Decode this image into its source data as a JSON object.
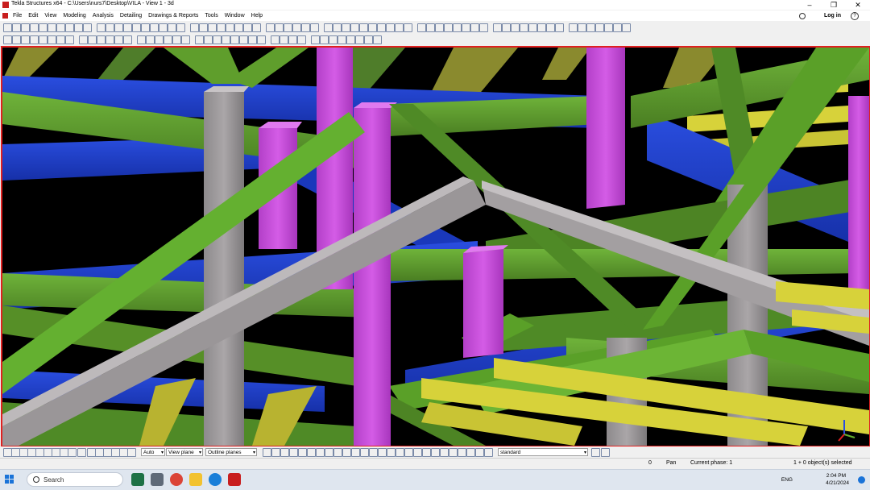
{
  "window": {
    "title": "Tekla Structures x64 - C:\\Users\\nurs7\\Desktop\\VILA - View 1 - 3d",
    "minimize_glyph": "–",
    "maximize_glyph": "❐",
    "close_glyph": "✕"
  },
  "menubar": {
    "items": [
      "File",
      "Edit",
      "View",
      "Modeling",
      "Analysis",
      "Detailing",
      "Drawings & Reports",
      "Tools",
      "Window",
      "Help"
    ],
    "login_label": "Log in",
    "help_glyph": "?"
  },
  "bottom_toolbar": {
    "zoom_combo": "Auto",
    "plane_combo": "View plane",
    "outline_combo": "Outline planes",
    "standard_combo": "standard"
  },
  "statusbar": {
    "number": "0",
    "mode": "Pan",
    "phase": "Current phase: 1",
    "selection": "1 + 0 object(s) selected"
  },
  "taskbar": {
    "search_placeholder": "Search",
    "language": "ENG",
    "time": "2:04 PM",
    "date": "4/21/2024"
  },
  "colors": {
    "viewport_border": "#e02020",
    "beam_blue": "#1f3fcf",
    "beam_green": "#5f9e2c",
    "beam_yellow": "#d7d23a",
    "column_magenta": "#c44ad6",
    "rafter_gray": "#9a9698"
  }
}
